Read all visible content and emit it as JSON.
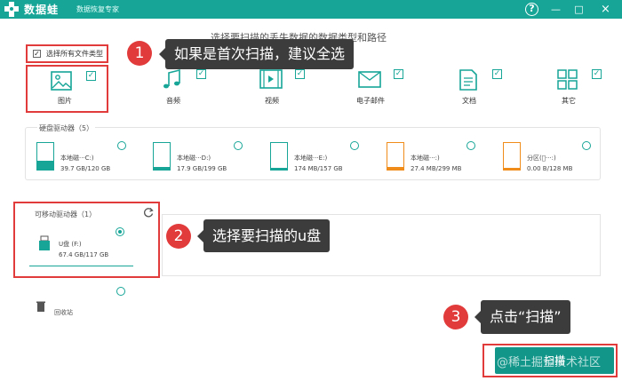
{
  "app": {
    "title": "数据蛙",
    "subtitle": "数据恢复专家"
  },
  "window": {
    "help": "?",
    "min": "—",
    "max": "□",
    "close": "×"
  },
  "instruction": "选择要扫描的丢失数据的数据类型和路径",
  "select_all": {
    "label": "选择所有文件类型",
    "checked": true
  },
  "file_types": [
    {
      "name": "图片",
      "icon": "image-icon",
      "checked": true
    },
    {
      "name": "音频",
      "icon": "music-icon",
      "checked": true
    },
    {
      "name": "视频",
      "icon": "video-icon",
      "checked": true
    },
    {
      "name": "电子邮件",
      "icon": "mail-icon",
      "checked": true
    },
    {
      "name": "文档",
      "icon": "document-icon",
      "checked": true
    },
    {
      "name": "其它",
      "icon": "other-icon",
      "checked": true
    }
  ],
  "hard_disk": {
    "title": "硬盘驱动器（5）",
    "drives": [
      {
        "name": "本地磁···C:)",
        "size": "39.7 GB/120 GB",
        "color": "#16a597",
        "fill_fraction": 0.33
      },
      {
        "name": "本地磁···D:)",
        "size": "17.9 GB/199 GB",
        "color": "#16a597",
        "fill_fraction": 0.09
      },
      {
        "name": "本地磁···E:)",
        "size": "174 MB/157 GB",
        "color": "#16a597",
        "fill_fraction": 0.02
      },
      {
        "name": "本地磁···:)",
        "size": "27.4 MB/299 MB",
        "color": "#f08c1a",
        "fill_fraction": 0.09
      },
      {
        "name": "分区(\u0000···:)",
        "size": "0.00  B/128 MB",
        "color": "#f08c1a",
        "fill_fraction": 0.0
      }
    ]
  },
  "removable": {
    "title": "可移动驱动器（1）",
    "drive": {
      "name": "U盘 (F:)",
      "size": "67.4 GB/117 GB",
      "selected": true
    }
  },
  "recycle": {
    "label": "回收站"
  },
  "callouts": [
    {
      "num": "1",
      "text": "如果是首次扫描，建议全选"
    },
    {
      "num": "2",
      "text": "选择要扫描的u盘"
    },
    {
      "num": "3",
      "text": "点击“扫描”"
    }
  ],
  "scan_button": {
    "label": "扫描"
  },
  "watermark": "@稀土掘金技术社区",
  "colors": {
    "accent": "#16a597",
    "highlight": "#e23b3b",
    "warning": "#f08c1a"
  }
}
